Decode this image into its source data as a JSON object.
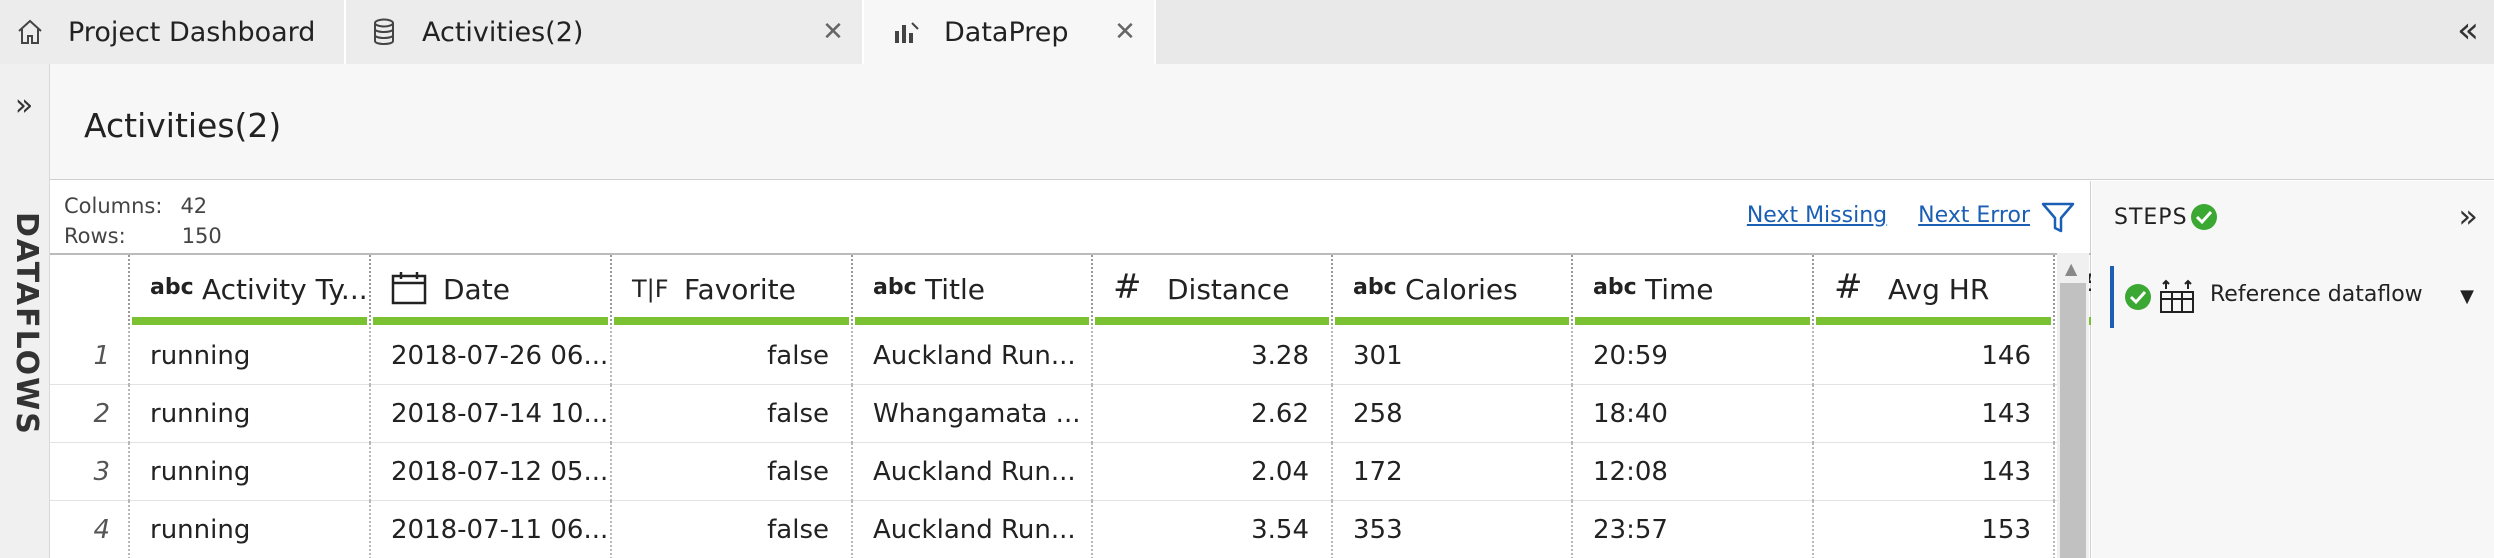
{
  "tabs": [
    {
      "label": "Project Dashboard",
      "icon": "home-icon",
      "closable": false
    },
    {
      "label": "Activities(2)",
      "icon": "database-icon",
      "closable": true
    },
    {
      "label": "DataPrep",
      "icon": "dataprep-icon",
      "closable": true,
      "active": true
    }
  ],
  "sidebar": {
    "label": "DATAFLOWS"
  },
  "main": {
    "title": "Activities(2)"
  },
  "meta": {
    "columns_label": "Columns:",
    "columns_value": "42",
    "rows_label": "Rows:",
    "rows_value": "150"
  },
  "links": {
    "next_missing": "Next Missing",
    "next_error": "Next Error"
  },
  "columns": [
    {
      "type": "abc",
      "label": "Activity Ty..."
    },
    {
      "type": "date",
      "label": "Date"
    },
    {
      "type": "T|F",
      "label": "Favorite"
    },
    {
      "type": "abc",
      "label": "Title"
    },
    {
      "type": "#",
      "label": "Distance"
    },
    {
      "type": "abc",
      "label": "Calories"
    },
    {
      "type": "abc",
      "label": "Time"
    },
    {
      "type": "#",
      "label": "Avg HR"
    }
  ],
  "rows": [
    {
      "n": "1",
      "cells": [
        "running",
        "2018-07-26 06...",
        "false",
        "Auckland Run...",
        "3.28",
        "301",
        "20:59",
        "146"
      ]
    },
    {
      "n": "2",
      "cells": [
        "running",
        "2018-07-14 10...",
        "false",
        "Whangamata ...",
        "2.62",
        "258",
        "18:40",
        "143"
      ]
    },
    {
      "n": "3",
      "cells": [
        "running",
        "2018-07-12 05...",
        "false",
        "Auckland Run...",
        "2.04",
        "172",
        "12:08",
        "143"
      ]
    },
    {
      "n": "4",
      "cells": [
        "running",
        "2018-07-11 06...",
        "false",
        "Auckland Run...",
        "3.54",
        "353",
        "23:57",
        "153"
      ]
    }
  ],
  "steps": {
    "title": "STEPS",
    "items": [
      {
        "label": "Reference dataflow",
        "status": "ok"
      }
    ]
  },
  "colors": {
    "accent": "#1a5fb4",
    "quality_bar": "#7ac231",
    "ok": "#3aa832"
  }
}
